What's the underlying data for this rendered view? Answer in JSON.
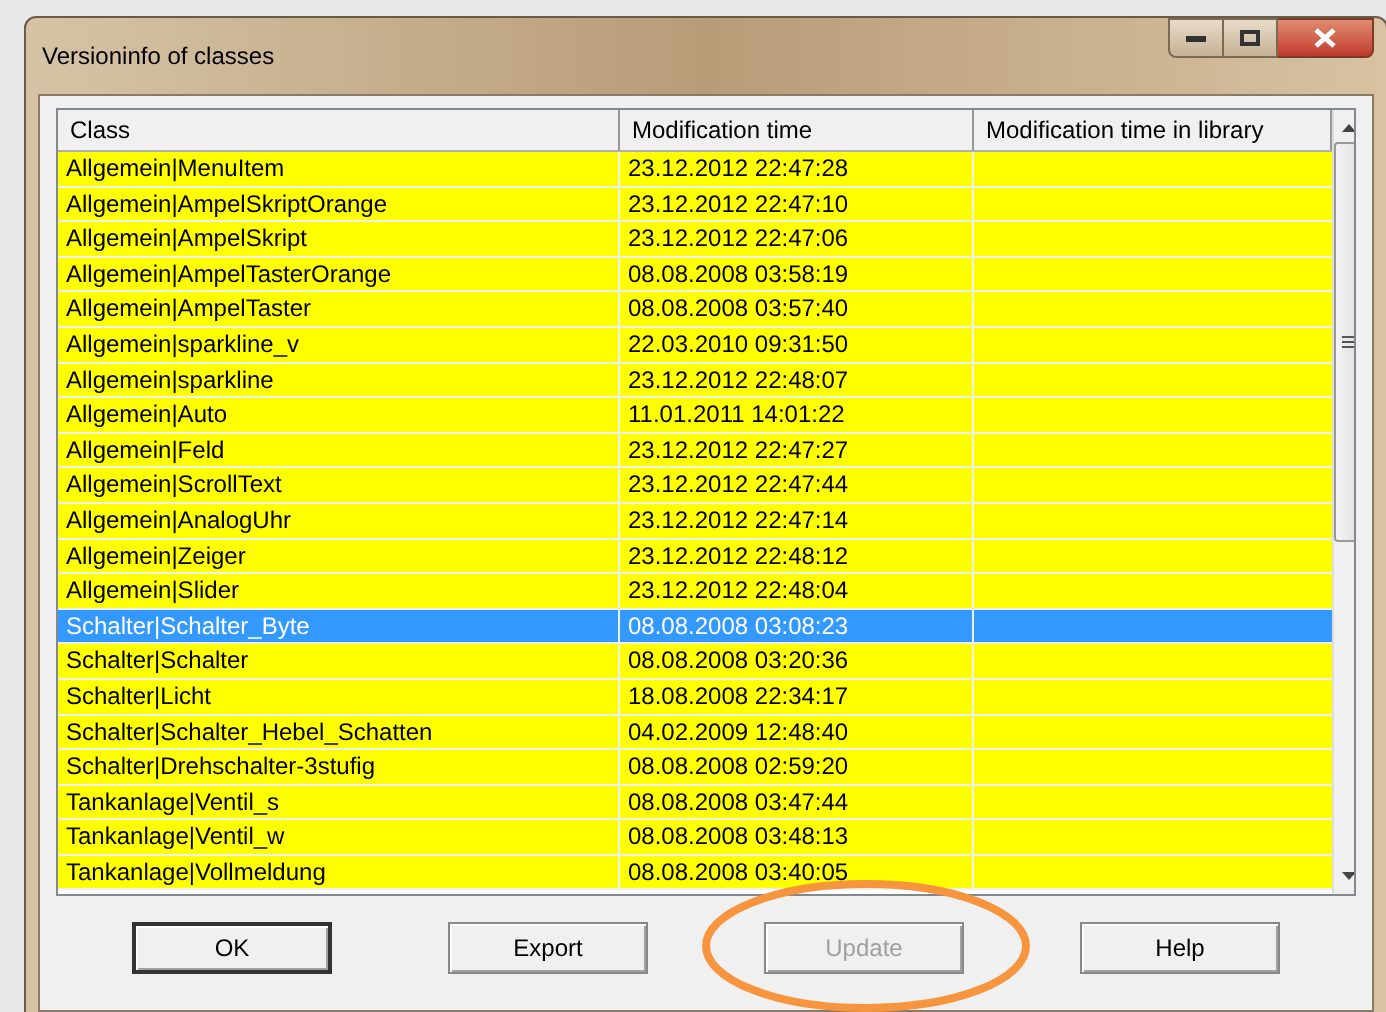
{
  "window": {
    "title": "Versioninfo of classes"
  },
  "table": {
    "columns": [
      "Class",
      "Modification time",
      "Modification time in library"
    ],
    "rows": [
      {
        "class": "Allgemein|MenuItem",
        "modified": "23.12.2012 22:47:28",
        "selected": false
      },
      {
        "class": "Allgemein|AmpelSkriptOrange",
        "modified": "23.12.2012 22:47:10",
        "selected": false
      },
      {
        "class": "Allgemein|AmpelSkript",
        "modified": "23.12.2012 22:47:06",
        "selected": false
      },
      {
        "class": "Allgemein|AmpelTasterOrange",
        "modified": "08.08.2008 03:58:19",
        "selected": false
      },
      {
        "class": "Allgemein|AmpelTaster",
        "modified": "08.08.2008 03:57:40",
        "selected": false
      },
      {
        "class": "Allgemein|sparkline_v",
        "modified": "22.03.2010 09:31:50",
        "selected": false
      },
      {
        "class": "Allgemein|sparkline",
        "modified": "23.12.2012 22:48:07",
        "selected": false
      },
      {
        "class": "Allgemein|Auto",
        "modified": "11.01.2011 14:01:22",
        "selected": false
      },
      {
        "class": "Allgemein|Feld",
        "modified": "23.12.2012 22:47:27",
        "selected": false
      },
      {
        "class": "Allgemein|ScrollText",
        "modified": "23.12.2012 22:47:44",
        "selected": false
      },
      {
        "class": "Allgemein|AnalogUhr",
        "modified": "23.12.2012 22:47:14",
        "selected": false
      },
      {
        "class": "Allgemein|Zeiger",
        "modified": "23.12.2012 22:48:12",
        "selected": false
      },
      {
        "class": "Allgemein|Slider",
        "modified": "23.12.2012 22:48:04",
        "selected": false
      },
      {
        "class": "Schalter|Schalter_Byte",
        "modified": "08.08.2008 03:08:23",
        "selected": true
      },
      {
        "class": "Schalter|Schalter",
        "modified": "08.08.2008 03:20:36",
        "selected": false
      },
      {
        "class": "Schalter|Licht",
        "modified": "18.08.2008 22:34:17",
        "selected": false
      },
      {
        "class": "Schalter|Schalter_Hebel_Schatten",
        "modified": "04.02.2009 12:48:40",
        "selected": false
      },
      {
        "class": "Schalter|Drehschalter-3stufig",
        "modified": "08.08.2008 02:59:20",
        "selected": false
      },
      {
        "class": "Tankanlage|Ventil_s",
        "modified": "08.08.2008 03:47:44",
        "selected": false
      },
      {
        "class": "Tankanlage|Ventil_w",
        "modified": "08.08.2008 03:48:13",
        "selected": false
      },
      {
        "class": "Tankanlage|Vollmeldung",
        "modified": "08.08.2008 03:40:05",
        "selected": false
      }
    ]
  },
  "buttons": [
    {
      "label": "OK",
      "disabled": false,
      "default": true,
      "circled": false
    },
    {
      "label": "Export",
      "disabled": false,
      "default": false,
      "circled": false
    },
    {
      "label": "Update",
      "disabled": true,
      "default": false,
      "circled": true
    },
    {
      "label": "Help",
      "disabled": false,
      "default": false,
      "circled": false
    }
  ]
}
